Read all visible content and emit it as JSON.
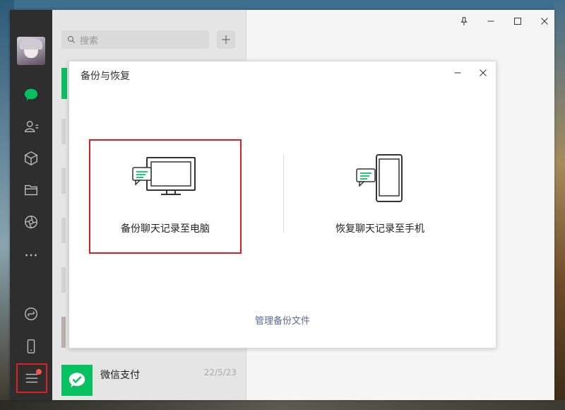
{
  "chatlist": {
    "search_placeholder": "搜索",
    "items": [
      {
        "name": "微信支付",
        "date": "22/5/23"
      }
    ]
  },
  "dialog": {
    "title": "备份与恢复",
    "backup_label": "备份聊天记录至电脑",
    "restore_label": "恢复聊天记录至手机",
    "manage_link": "管理备份文件"
  },
  "icons": {
    "sidebar": [
      "chat-icon",
      "contacts-icon",
      "favorites-icon",
      "files-icon",
      "moments-icon",
      "more-icon",
      "miniprogram-icon",
      "phone-icon",
      "menu-icon"
    ],
    "window": [
      "pin-icon",
      "minimize-icon",
      "maximize-icon",
      "close-icon"
    ]
  },
  "colors": {
    "accent_green": "#07c160",
    "highlight_red": "#d81e1e",
    "link_blue": "#576b95",
    "sidebar_bg": "#2e2e2e"
  }
}
